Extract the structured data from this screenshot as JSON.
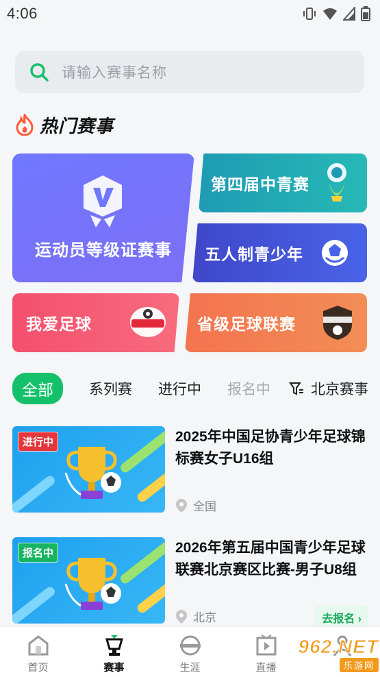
{
  "status": {
    "time": "4:06"
  },
  "search": {
    "placeholder": "请输入赛事名称"
  },
  "hot": {
    "title": "热门赛事",
    "cards": [
      {
        "label": "运动员等级证赛事",
        "icon": "shield-v-icon"
      },
      {
        "label": "第四届中青赛",
        "icon": "mascot-logo-icon"
      },
      {
        "label": "五人制青少年",
        "icon": "futsal-ball-icon"
      },
      {
        "label": "我爱足球",
        "icon": "i-love-football-logo"
      },
      {
        "label": "省级足球联赛",
        "icon": "provincial-league-logo"
      }
    ]
  },
  "tabs": {
    "items": [
      "全部",
      "系列赛",
      "进行中",
      "报名中"
    ],
    "active": "全部",
    "filter_label": "北京赛事"
  },
  "events": [
    {
      "badge": "进行中",
      "title": "2025年中国足协青少年足球锦标赛女子U16组",
      "location": "全国"
    },
    {
      "badge": "报名中",
      "title": "2026年第五届中国青少年足球联赛北京赛区比赛-男子U8组",
      "location": "北京",
      "action": "去报名"
    }
  ],
  "nav": {
    "items": [
      "首页",
      "赛事",
      "生涯",
      "直播",
      ""
    ],
    "active": "赛事"
  },
  "watermark": {
    "brand": "962.NET",
    "sub": "乐游网"
  },
  "colors": {
    "accent": "#14c06a",
    "live_badge": "#e4363c",
    "signup_badge": "#18b462"
  }
}
